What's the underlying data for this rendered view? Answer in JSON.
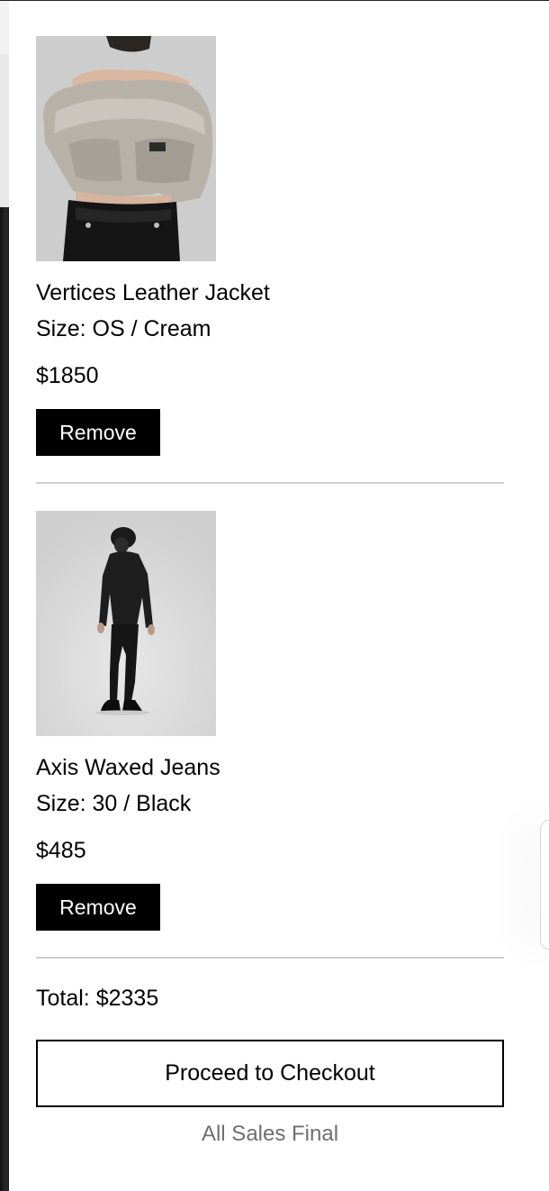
{
  "cart": {
    "items": [
      {
        "image_alt": "Vertices Leather Jacket photo",
        "name": "Vertices Leather Jacket",
        "variant": "Size: OS / Cream",
        "price": "$1850",
        "remove_label": "Remove"
      },
      {
        "image_alt": "Axis Waxed Jeans photo",
        "name": "Axis Waxed Jeans",
        "variant": "Size: 30 / Black",
        "price": "$485",
        "remove_label": "Remove"
      }
    ],
    "total": "Total: $2335",
    "checkout_label": "Proceed to Checkout",
    "notice": "All Sales Final"
  },
  "colors": {
    "button_bg": "#000000",
    "button_text": "#ffffff",
    "divider": "#cfcfcf",
    "muted_text": "#6f6f6f"
  }
}
